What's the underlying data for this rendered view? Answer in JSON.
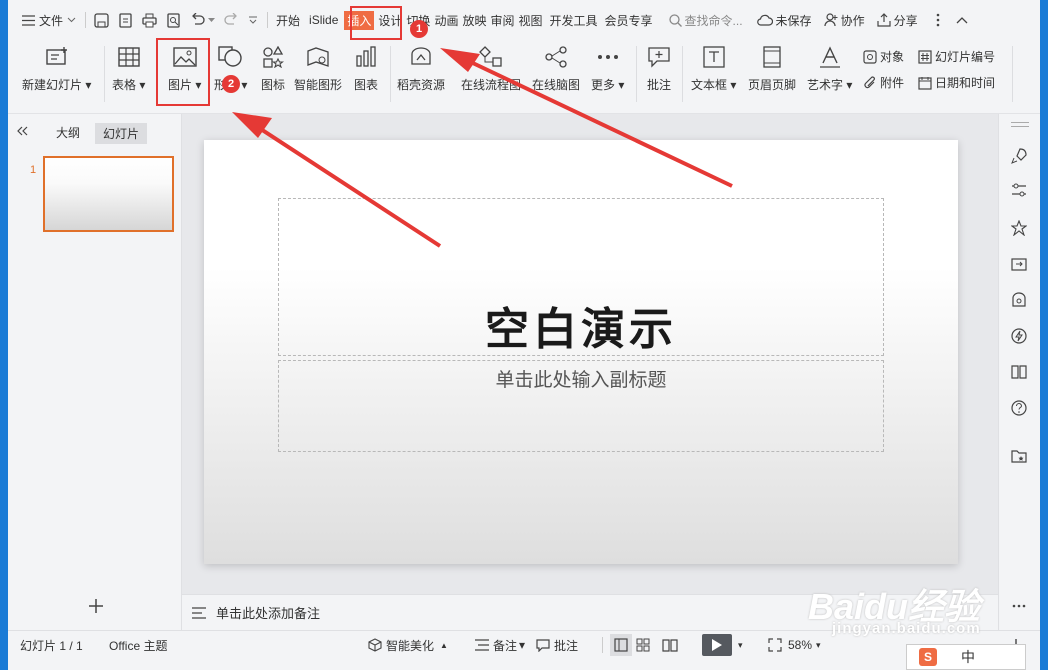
{
  "titlebar": {
    "file_label": "文件",
    "tabs": [
      "开始",
      "iSlide",
      "插入",
      "设计",
      "切换",
      "动画",
      "放映",
      "审阅",
      "视图",
      "开发工具",
      "会员专享"
    ],
    "active_tab": "插入",
    "search_placeholder": "查找命令...",
    "unsaved_label": "未保存",
    "collab_label": "协作",
    "share_label": "分享"
  },
  "ribbon": {
    "new_slide": "新建幻灯片",
    "table": "表格",
    "picture": "图片",
    "shape": "形状",
    "icon": "图标",
    "smart_art": "智能图形",
    "chart": "图表",
    "docer": "稻壳资源",
    "flowchart": "在线流程图",
    "mindmap": "在线脑图",
    "more": "更多",
    "comment": "批注",
    "textbox": "文本框",
    "header_footer": "页眉页脚",
    "wordart": "艺术字",
    "object": "对象",
    "attachment": "附件",
    "slide_number": "幻灯片编号",
    "datetime": "日期和时间"
  },
  "leftpane": {
    "outline_tab": "大纲",
    "slides_tab": "幻灯片",
    "slide_index": "1"
  },
  "slide": {
    "title": "空白演示",
    "subtitle": "单击此处输入副标题"
  },
  "notes_placeholder": "单击此处添加备注",
  "status": {
    "slide_count": "幻灯片 1 / 1",
    "theme": "Office 主题",
    "beautify": "智能美化",
    "notes": "备注",
    "comment": "批注",
    "zoom": "58%"
  },
  "annotations": {
    "badge1": "1",
    "badge2": "2",
    "accent": "#e53935"
  },
  "watermark": {
    "brand": "Baidu经验",
    "url": "jingyan.baidu.com"
  },
  "ime": {
    "lang": "中"
  }
}
